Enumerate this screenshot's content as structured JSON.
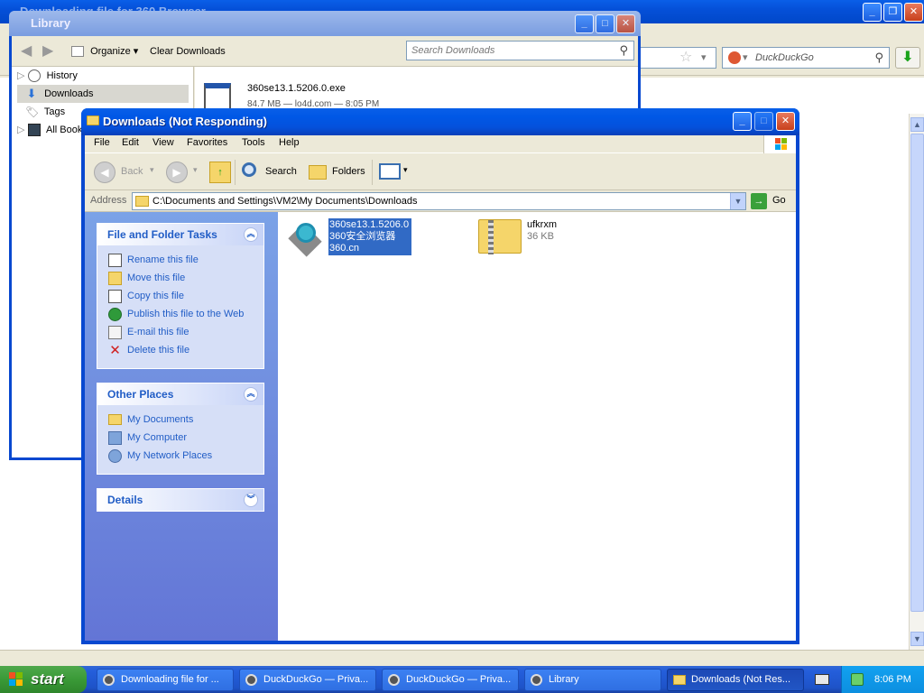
{
  "browser": {
    "title": "Downloading file for 360 Browser...",
    "search_placeholder": "DuckDuckGo"
  },
  "library": {
    "title": "Library",
    "toolbar": {
      "organize_label": "Organize",
      "clear_label": "Clear Downloads",
      "search_placeholder": "Search Downloads"
    },
    "nav": [
      {
        "label": "History"
      },
      {
        "label": "Downloads"
      },
      {
        "label": "Tags"
      },
      {
        "label": "All Bookmarks"
      }
    ],
    "download": {
      "name": "360se13.1.5206.0.exe",
      "meta": "84.7 MB — lo4d.com — 8:05 PM"
    }
  },
  "explorer": {
    "title": "Downloads (Not Responding)",
    "menu": [
      "File",
      "Edit",
      "View",
      "Favorites",
      "Tools",
      "Help"
    ],
    "toolbar": {
      "back_label": "Back",
      "search_label": "Search",
      "folders_label": "Folders"
    },
    "address": {
      "label": "Address",
      "path": "C:\\Documents and Settings\\VM2\\My Documents\\Downloads",
      "go_label": "Go"
    },
    "file_tasks": {
      "title": "File and Folder Tasks",
      "items": [
        {
          "label": "Rename this file",
          "icon": "rename-icon"
        },
        {
          "label": "Move this file",
          "icon": "move-icon"
        },
        {
          "label": "Copy this file",
          "icon": "copy-icon"
        },
        {
          "label": "Publish this file to the Web",
          "icon": "globe-icon"
        },
        {
          "label": "E-mail this file",
          "icon": "email-icon"
        },
        {
          "label": "Delete this file",
          "icon": "delete-icon"
        }
      ]
    },
    "other_places": {
      "title": "Other Places",
      "items": [
        {
          "label": "My Documents",
          "icon": "folder-icon"
        },
        {
          "label": "My Computer",
          "icon": "computer-icon"
        },
        {
          "label": "My Network Places",
          "icon": "network-icon"
        }
      ]
    },
    "details": {
      "title": "Details"
    },
    "files": [
      {
        "line1": "360se13.1.5206.0",
        "line2": "360安全浏览器",
        "line3": "360.cn",
        "selected": true
      },
      {
        "name": "ufkrxm",
        "size": "36 KB"
      }
    ]
  },
  "taskbar": {
    "start_label": "start",
    "tasks": [
      {
        "label": "Downloading file for ..."
      },
      {
        "label": "DuckDuckGo — Priva..."
      },
      {
        "label": "DuckDuckGo — Priva..."
      },
      {
        "label": "Library"
      },
      {
        "label": "Downloads (Not Res..."
      }
    ],
    "clock": "8:06 PM"
  },
  "colors": {
    "xp_blue": "#0a5fe8",
    "task_link": "#215dc6",
    "selection": "#316ac5"
  }
}
